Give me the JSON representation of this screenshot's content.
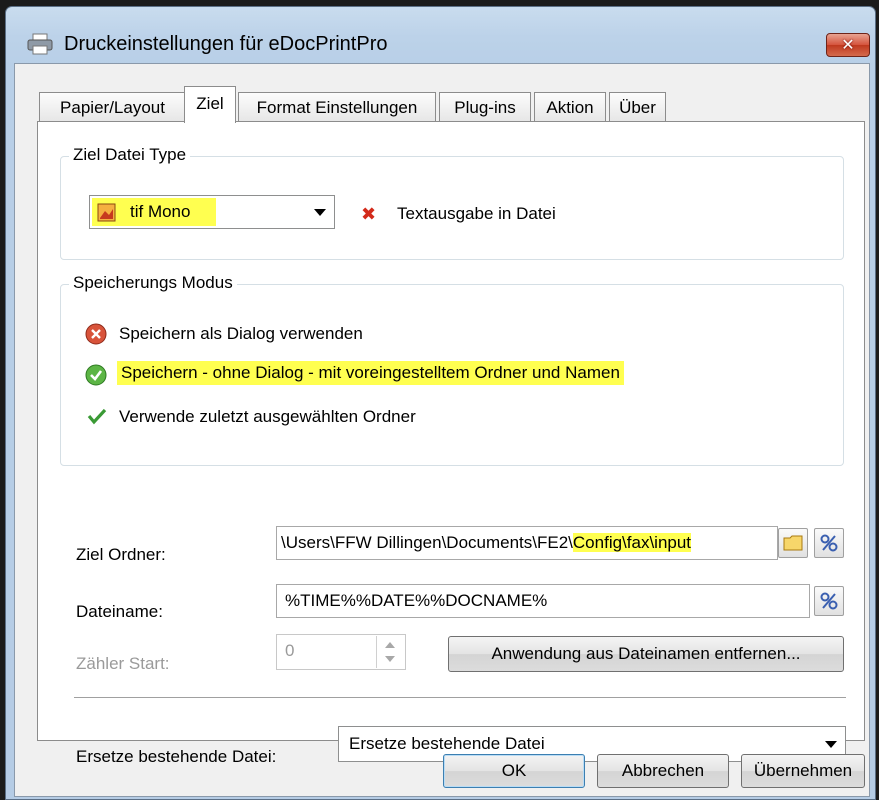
{
  "window": {
    "title": "Druckeinstellungen für eDocPrintPro"
  },
  "tabs": [
    {
      "label": "Papier/Layout"
    },
    {
      "label": "Ziel"
    },
    {
      "label": "Format Einstellungen"
    },
    {
      "label": "Plug-ins"
    },
    {
      "label": "Aktion"
    },
    {
      "label": "Über"
    }
  ],
  "ziel_datei_type": {
    "legend": "Ziel Datei Type",
    "selected": "tif Mono",
    "text_output_label": "Textausgabe in Datei"
  },
  "speicherungs_modus": {
    "legend": "Speicherungs Modus",
    "options": [
      {
        "label": "Speichern als Dialog verwenden"
      },
      {
        "label": "Speichern - ohne Dialog - mit voreingestelltem Ordner und Namen"
      },
      {
        "label": "Verwende zuletzt ausgewählten Ordner"
      }
    ]
  },
  "ziel_ordner": {
    "label": "Ziel Ordner:",
    "value_prefix": "\\Users\\FFW Dillingen\\Documents\\FE2\\",
    "value_highlight": "Config\\fax\\input"
  },
  "dateiname": {
    "label": "Dateiname:",
    "value": "%TIME%%DATE%%DOCNAME%"
  },
  "zaehler": {
    "label": "Zähler Start:",
    "value": "0"
  },
  "remove_app_button": "Anwendung aus Dateinamen entfernen...",
  "ersetze": {
    "label": "Ersetze bestehende Datei:",
    "selected": "Ersetze bestehende Datei"
  },
  "buttons": {
    "ok": "OK",
    "cancel": "Abbrechen",
    "apply": "Übernehmen"
  },
  "colors": {
    "highlight": "#ffff50",
    "close_red": "#c0391f"
  }
}
